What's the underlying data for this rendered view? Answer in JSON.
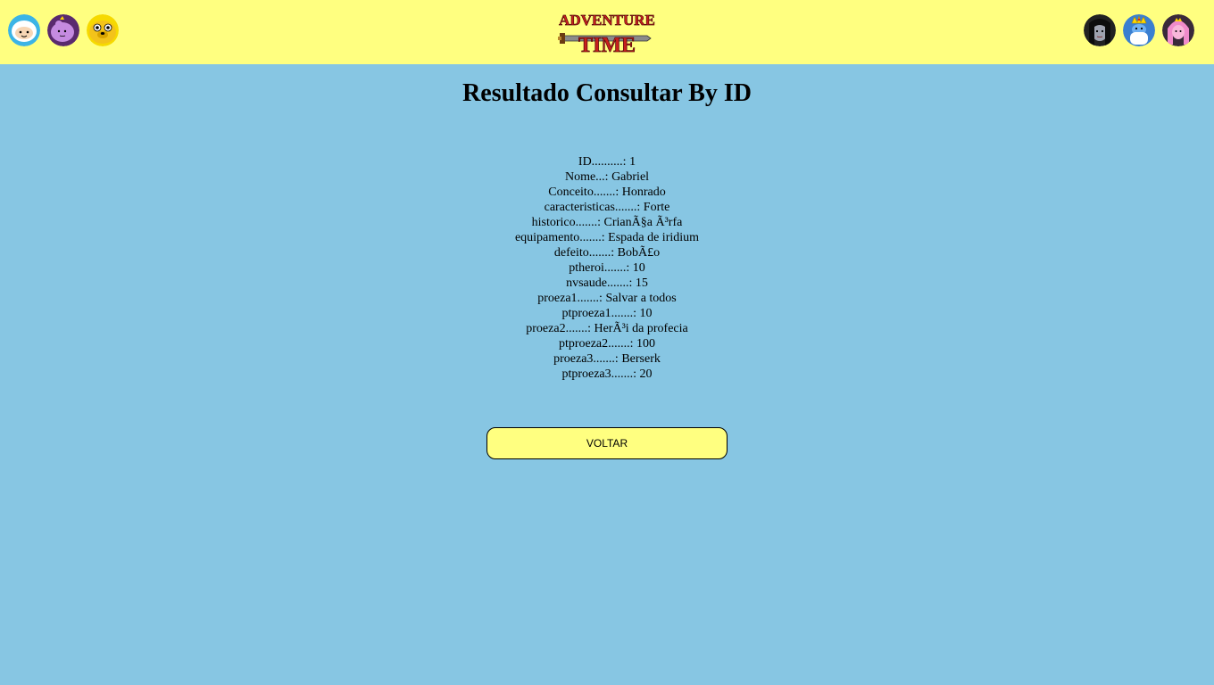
{
  "header": {
    "left_avatars": [
      {
        "icon": "finn-avatar-icon",
        "bg": "#3cb4e6"
      },
      {
        "icon": "lumpy-space-princess-avatar-icon",
        "bg": "#5a2a6e"
      },
      {
        "icon": "jake-avatar-icon",
        "bg": "#f6d900"
      }
    ],
    "right_avatars": [
      {
        "icon": "marceline-avatar-icon",
        "bg": "#222222"
      },
      {
        "icon": "ice-king-avatar-icon",
        "bg": "#3a7fd0"
      },
      {
        "icon": "princess-bubblegum-avatar-icon",
        "bg": "#3a2a3a"
      }
    ],
    "logo": {
      "icon": "adventure-time-logo",
      "line1": "ADVENTURE",
      "line2": "TIME"
    }
  },
  "page": {
    "title": "Resultado Consultar By ID"
  },
  "record": {
    "fields": [
      {
        "label": "ID..........:",
        "value": "1"
      },
      {
        "label": "Nome...:",
        "value": "Gabriel"
      },
      {
        "label": "Conceito.......:",
        "value": "Honrado"
      },
      {
        "label": "caracteristicas.......:",
        "value": "Forte"
      },
      {
        "label": "historico.......:",
        "value": "CrianÃ§a Ã³rfa"
      },
      {
        "label": "equipamento.......:",
        "value": "Espada de iridium"
      },
      {
        "label": "defeito.......:",
        "value": "BobÃ£o"
      },
      {
        "label": "ptheroi.......:",
        "value": "10"
      },
      {
        "label": "nvsaude.......:",
        "value": "15"
      },
      {
        "label": "proeza1.......:",
        "value": "Salvar a todos"
      },
      {
        "label": "ptproeza1.......:",
        "value": "10"
      },
      {
        "label": "proeza2.......:",
        "value": "HerÃ³i da profecia"
      },
      {
        "label": "ptproeza2.......:",
        "value": "100"
      },
      {
        "label": "proeza3.......:",
        "value": "Berserk"
      },
      {
        "label": "ptproeza3.......:",
        "value": "20"
      }
    ]
  },
  "actions": {
    "back_label": "VOLTAR"
  },
  "colors": {
    "background": "#87c6e3",
    "header": "#ffff80",
    "button": "#ffff80"
  }
}
